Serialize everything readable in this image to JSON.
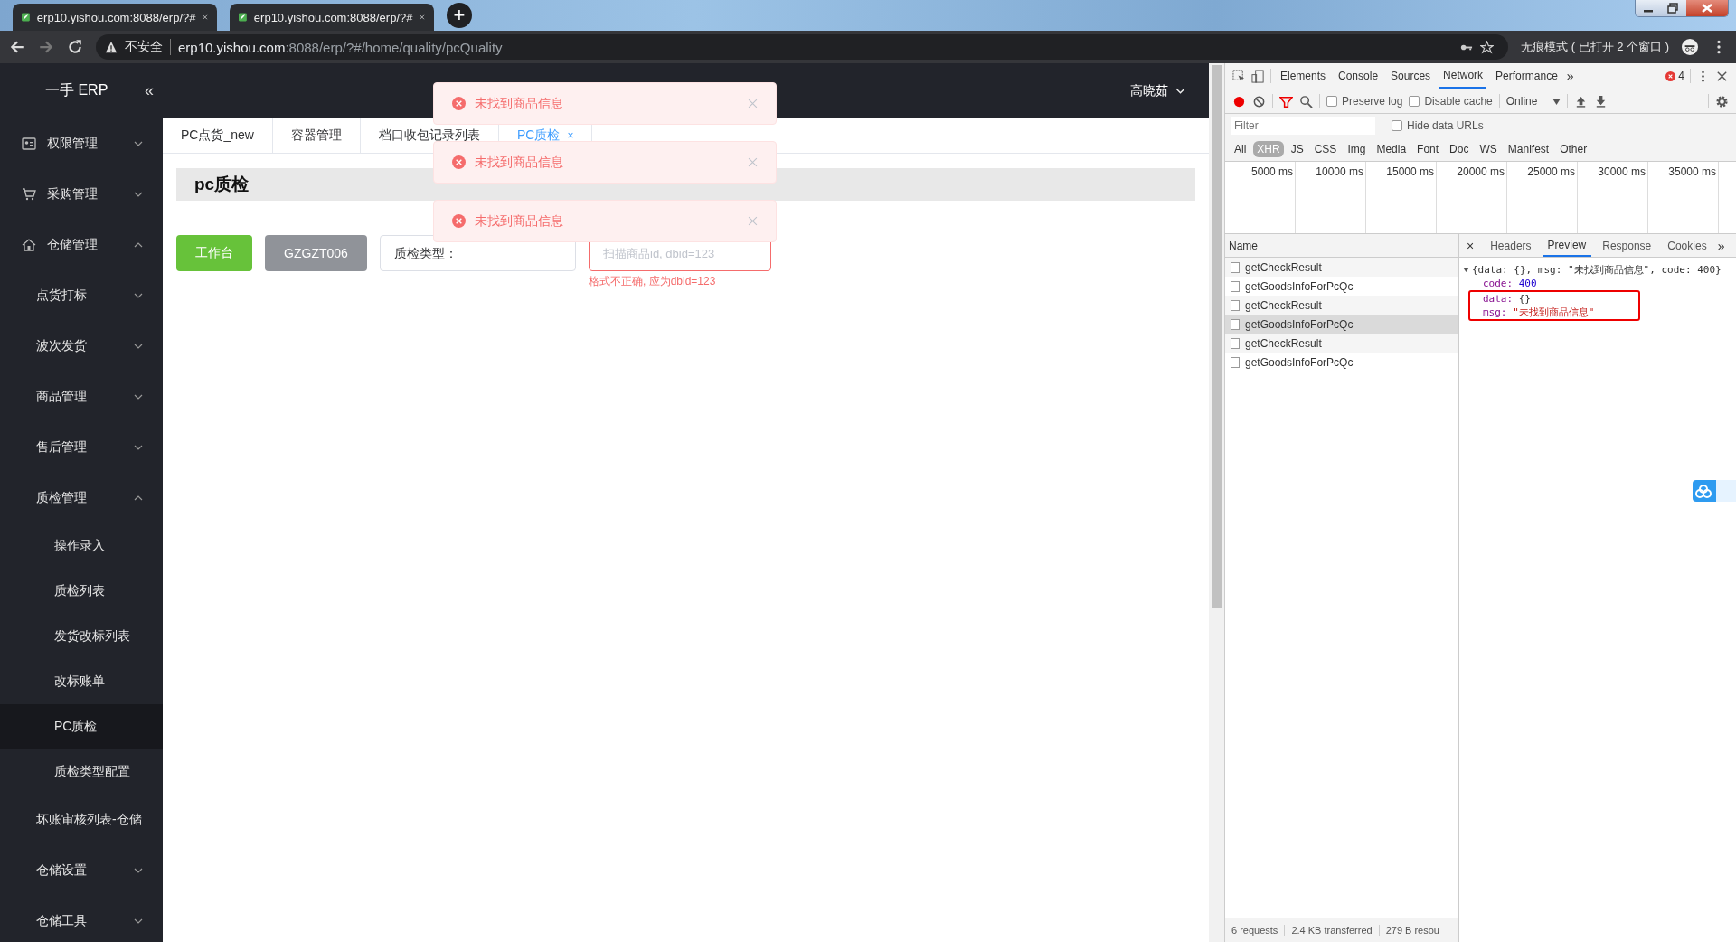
{
  "browser": {
    "tabs": [
      {
        "title": "erp10.yishou.com:8088/erp/?#"
      },
      {
        "title": "erp10.yishou.com:8088/erp/?#"
      }
    ],
    "new_tab": "+",
    "address": {
      "security": "不安全",
      "host": "erp10.yishou.com",
      "rest": ":8088/erp/?#/home/quality/pcQuality"
    },
    "incognito": "无痕模式 ( 已打开 2 个窗口 )"
  },
  "app": {
    "logo": "一手 ERP",
    "collapse": "«",
    "user": "高晓茹",
    "sidebar": [
      {
        "label": "权限管理",
        "expanded": false
      },
      {
        "label": "采购管理",
        "expanded": false
      },
      {
        "label": "仓储管理",
        "expanded": true,
        "children": [
          {
            "label": "点货打标",
            "expanded": false
          },
          {
            "label": "波次发货",
            "expanded": false
          },
          {
            "label": "商品管理",
            "expanded": false
          },
          {
            "label": "售后管理",
            "expanded": false
          },
          {
            "label": "质检管理",
            "expanded": true,
            "children": [
              {
                "label": "操作录入",
                "selected": false
              },
              {
                "label": "质检列表",
                "selected": false
              },
              {
                "label": "发货改标列表",
                "selected": false
              },
              {
                "label": "改标账单",
                "selected": false
              },
              {
                "label": "PC质检",
                "selected": true
              },
              {
                "label": "质检类型配置",
                "selected": false
              }
            ]
          },
          {
            "label": "坏账审核列表-仓储"
          },
          {
            "label": "仓储设置",
            "expanded": false
          },
          {
            "label": "仓储工具",
            "expanded": false
          }
        ]
      }
    ],
    "tabs": [
      {
        "label": "PC点货_new",
        "selected": false
      },
      {
        "label": "容器管理",
        "selected": false
      },
      {
        "label": "档口收包记录列表",
        "selected": false
      },
      {
        "label": "PC质检",
        "selected": true,
        "close": "×"
      }
    ],
    "page_title": "pc质检",
    "workbench_button": "工作台",
    "station_button": "GZGZT006",
    "type_select": {
      "placeholder": "质检类型："
    },
    "scan_field": {
      "placeholder": "扫描商品id, dbid=123",
      "invalid": true
    },
    "error": "格式不正确, 应为dbid=123",
    "toasts": [
      {
        "message": "未找到商品信息"
      },
      {
        "message": "未找到商品信息"
      },
      {
        "message": "未找到商品信息"
      }
    ]
  },
  "devtools": {
    "tabs": [
      {
        "label": "Elements",
        "selected": false
      },
      {
        "label": "Console",
        "selected": false
      },
      {
        "label": "Sources",
        "selected": false
      },
      {
        "label": "Network",
        "selected": true
      },
      {
        "label": "Performance",
        "selected": false
      }
    ],
    "more": "»",
    "error_count": "4",
    "options": [
      {
        "label": "Preserve log",
        "checked": false
      },
      {
        "label": "Disable cache",
        "checked": false
      }
    ],
    "throttle": "Online",
    "filter": {
      "placeholder": "Filter"
    },
    "hide_data_urls": {
      "label": "Hide data URLs",
      "checked": false
    },
    "types": [
      {
        "label": "All",
        "selected": false
      },
      {
        "label": "XHR",
        "selected": true
      },
      {
        "label": "JS",
        "selected": false
      },
      {
        "label": "CSS",
        "selected": false
      },
      {
        "label": "Img",
        "selected": false
      },
      {
        "label": "Media",
        "selected": false
      },
      {
        "label": "Font",
        "selected": false
      },
      {
        "label": "Doc",
        "selected": false
      },
      {
        "label": "WS",
        "selected": false
      },
      {
        "label": "Manifest",
        "selected": false
      },
      {
        "label": "Other",
        "selected": false
      }
    ],
    "timeline": [
      "5000 ms",
      "10000 ms",
      "15000 ms",
      "20000 ms",
      "25000 ms",
      "30000 ms",
      "35000 ms"
    ],
    "name_header": "Name",
    "requests": [
      {
        "name": "getCheckResult",
        "selected": false
      },
      {
        "name": "getGoodsInfoForPcQc",
        "selected": false
      },
      {
        "name": "getCheckResult",
        "selected": false
      },
      {
        "name": "getGoodsInfoForPcQc",
        "selected": true
      },
      {
        "name": "getCheckResult",
        "selected": false
      },
      {
        "name": "getGoodsInfoForPcQc",
        "selected": false
      }
    ],
    "detail_close": "×",
    "detail_tabs": [
      {
        "label": "Headers",
        "selected": false
      },
      {
        "label": "Preview",
        "selected": true
      },
      {
        "label": "Response",
        "selected": false
      },
      {
        "label": "Cookies",
        "selected": false
      }
    ],
    "detail_more": "»",
    "preview": {
      "summary": "{data: {}, msg: \"未找到商品信息\", code: 400}",
      "props": [
        {
          "key": "code:",
          "value": "400",
          "kind": "number",
          "boxed": false
        },
        {
          "key": "data:",
          "value": "{}",
          "kind": "object",
          "boxed": true
        },
        {
          "key": "msg:",
          "value": "\"未找到商品信息\"",
          "kind": "string",
          "boxed": true
        }
      ]
    },
    "footer": [
      "6 requests",
      "2.4 KB transferred",
      "279 B resou"
    ]
  }
}
